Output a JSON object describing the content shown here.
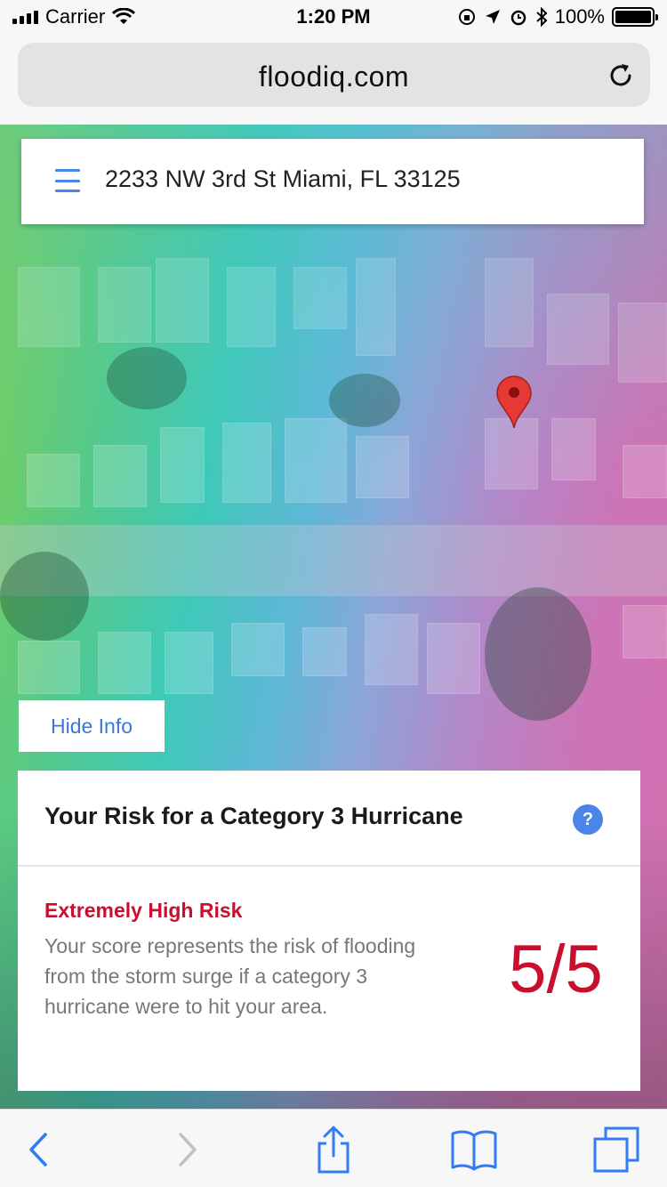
{
  "status_bar": {
    "carrier": "Carrier",
    "time": "1:20 PM",
    "battery": "100%"
  },
  "browser": {
    "url": "floodiq.com"
  },
  "search": {
    "address": "2233 NW 3rd St Miami, FL 33125"
  },
  "hide_info_label": "Hide Info",
  "risk": {
    "title": "Your Risk for a Category 3 Hurricane",
    "help": "?",
    "level": "Extremely High Risk",
    "description": "Your score represents the risk of flooding from the storm surge if a category 3 hurricane were to hit your area.",
    "score": "5/5"
  },
  "colors": {
    "accent_blue": "#4a86e8",
    "risk_red": "#c8102e"
  },
  "icons": {
    "menu": "hamburger-icon",
    "map_marker": "map-pin-icon",
    "reload": "reload-icon",
    "back": "chevron-left-icon",
    "forward": "chevron-right-icon",
    "share": "share-icon",
    "bookmarks": "book-icon",
    "tabs": "tabs-icon"
  }
}
